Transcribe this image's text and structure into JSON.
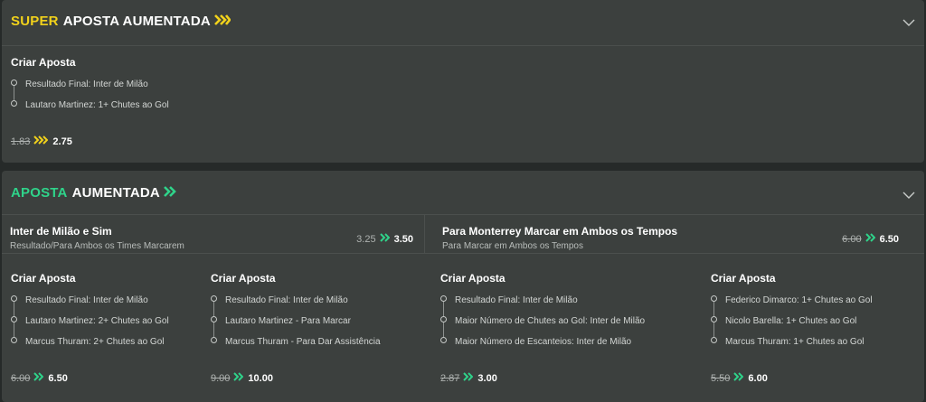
{
  "super": {
    "title_part1": "SUPER",
    "title_part2": "APOSTA AUMENTADA",
    "card": {
      "heading": "Criar Aposta",
      "legs": [
        "Resultado Final: Inter de Milão",
        "Lautaro Martinez: 1+ Chutes ao Gol"
      ],
      "old_odds": "1.83",
      "new_odds": "2.75"
    }
  },
  "aposta": {
    "title_part1": "APOSTA",
    "title_part2": "AUMENTADA",
    "top": [
      {
        "title": "Inter de Milão e Sim",
        "subtitle": "Resultado/Para Ambos os Times Marcarem",
        "old_odds": "3.25",
        "new_odds": "3.50"
      },
      {
        "title": "Para Monterrey Marcar em Ambos os Tempos",
        "subtitle": "Para Marcar em Ambos os Tempos",
        "old_odds": "6.00",
        "new_odds": "6.50"
      }
    ],
    "cards": [
      {
        "heading": "Criar Aposta",
        "legs": [
          "Resultado Final: Inter de Milão",
          "Lautaro Martinez: 2+ Chutes ao Gol",
          "Marcus Thuram: 2+ Chutes ao Gol"
        ],
        "old_odds": "6.00",
        "new_odds": "6.50"
      },
      {
        "heading": "Criar Aposta",
        "legs": [
          "Resultado Final: Inter de Milão",
          "Lautaro Martinez - Para Marcar",
          "Marcus Thuram - Para Dar Assistência"
        ],
        "old_odds": "9.00",
        "new_odds": "10.00"
      },
      {
        "heading": "Criar Aposta",
        "legs": [
          "Resultado Final: Inter de Milão",
          "Maior Número de Chutes ao Gol: Inter de Milão",
          "Maior Número de Escanteios: Inter de Milão"
        ],
        "old_odds": "2.87",
        "new_odds": "3.00"
      },
      {
        "heading": "Criar Aposta",
        "legs": [
          "Federico Dimarco: 1+ Chutes ao Gol",
          "Nicolo Barella: 1+ Chutes ao Gol",
          "Marcus Thuram: 1+ Chutes ao Gol"
        ],
        "old_odds": "5.50",
        "new_odds": "6.00"
      }
    ]
  },
  "colors": {
    "super_accent": "#f2d21b",
    "aposta_accent": "#2fd38a",
    "panel_bg": "#3c403e",
    "page_bg": "#262a29"
  },
  "icons": {
    "boost": "double-chevron-right-icon",
    "collapse": "chevron-down-icon"
  }
}
